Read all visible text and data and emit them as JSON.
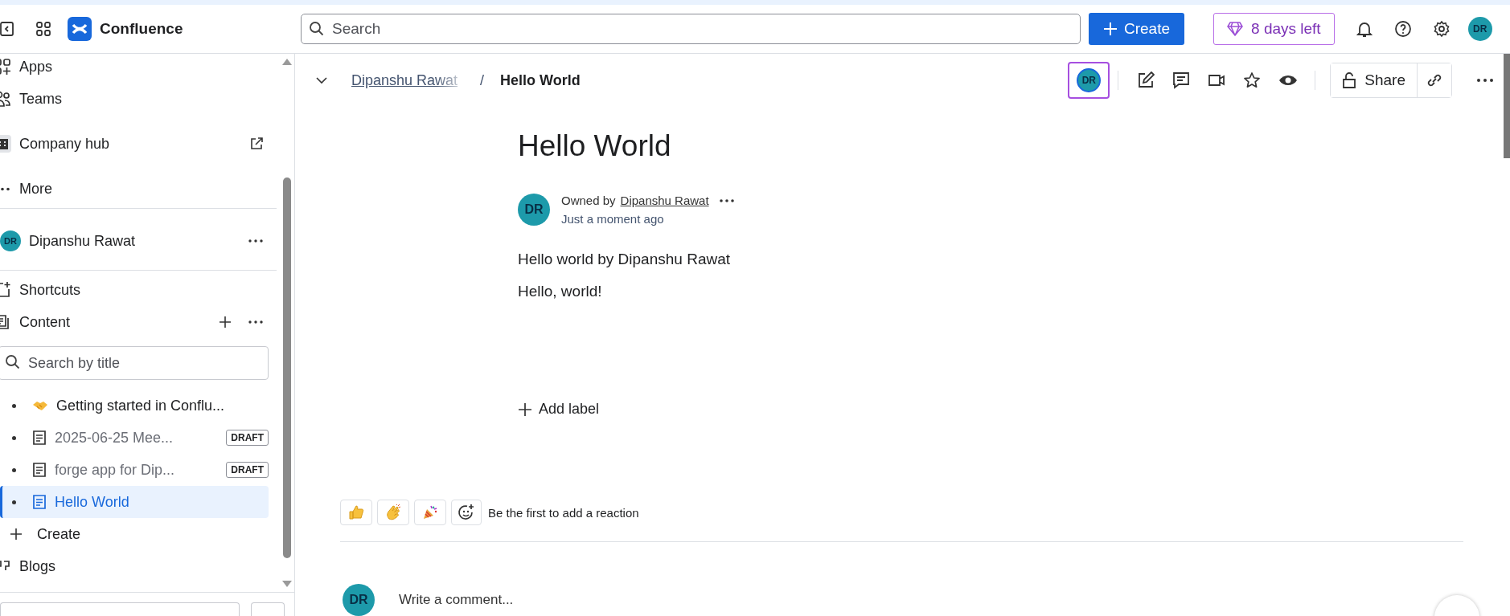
{
  "top_bar": {
    "product": "Confluence",
    "search": {
      "placeholder": "Search"
    },
    "create": "Create",
    "trial": "8 days left",
    "avatar": "DR"
  },
  "sidebar": {
    "nav": [
      {
        "label": "Apps",
        "kind": "apps"
      },
      {
        "label": "Teams",
        "kind": "teams"
      },
      {
        "label": "Company hub",
        "kind": "hub"
      },
      {
        "label": "More",
        "kind": "more"
      }
    ],
    "space": {
      "name": "Dipanshu Rawat",
      "avatar": "DR"
    },
    "sections": [
      {
        "label": "Shortcuts",
        "kind": "shortcuts"
      },
      {
        "label": "Content",
        "kind": "content"
      }
    ],
    "search": {
      "placeholder": "Search by title"
    },
    "tree": [
      {
        "title": "Getting started in Conflu...",
        "kind": "emoji",
        "selected": false
      },
      {
        "title": "2025-06-25 Mee...",
        "kind": "page",
        "badge": "DRAFT",
        "selected": false
      },
      {
        "title": "forge app for Dip...",
        "kind": "page",
        "badge": "DRAFT",
        "selected": false
      },
      {
        "title": "Hello World",
        "kind": "page",
        "selected": true
      }
    ],
    "create": "Create",
    "blogs": "Blogs"
  },
  "page_header": {
    "breadcrumb": "Dipanshu Rawat",
    "separator": "/",
    "current": "Hello World",
    "viewer": {
      "avatar": "DR",
      "highlighted": true
    },
    "share": "Share"
  },
  "page": {
    "title": "Hello World",
    "owner_prefix": "Owned by",
    "owner": "Dipanshu Rawat",
    "owner_avatar": "DR",
    "updated": "Just a moment ago",
    "body": [
      "Hello world by Dipanshu Rawat",
      "Hello, world!"
    ],
    "add_label": "Add label",
    "reactions": [
      {
        "kind": "thumbs"
      },
      {
        "kind": "clap"
      },
      {
        "kind": "party"
      }
    ],
    "reaction_prompt": "Be the first to add a reaction",
    "comment": {
      "avatar": "DR",
      "placeholder": "Write a comment..."
    }
  }
}
